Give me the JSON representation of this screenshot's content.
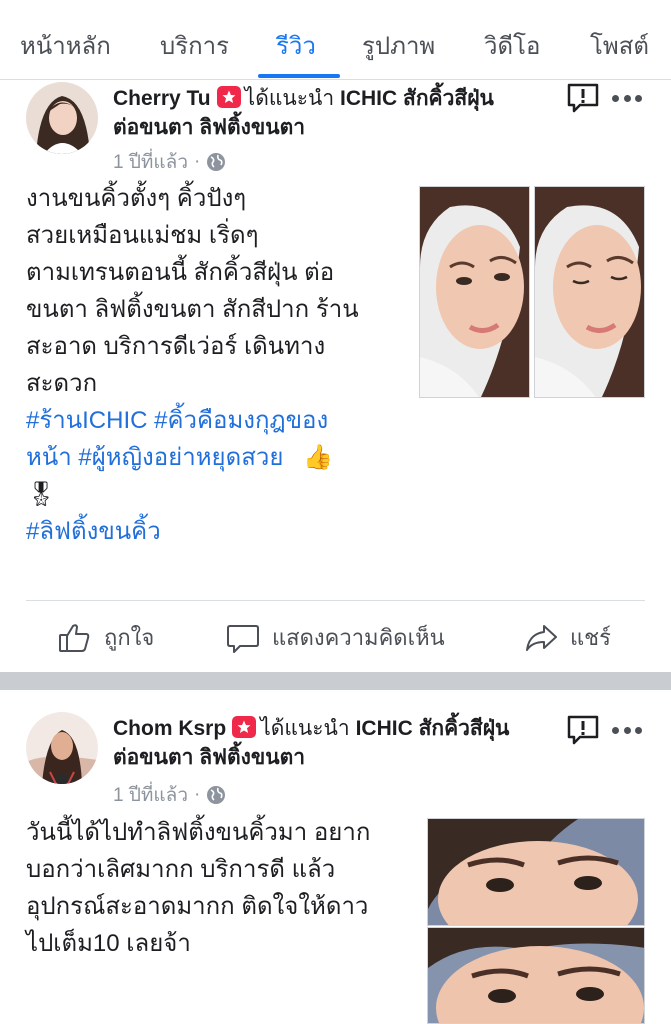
{
  "tabs": [
    {
      "label": "หน้าหลัก",
      "active": false
    },
    {
      "label": "บริการ",
      "active": false
    },
    {
      "label": "รีวิว",
      "active": true
    },
    {
      "label": "รูปภาพ",
      "active": false
    },
    {
      "label": "วิดีโอ",
      "active": false
    },
    {
      "label": "โพสต์",
      "active": false
    }
  ],
  "posts": [
    {
      "author": "Cherry Tu",
      "recommend_text": "ได้แนะนำ",
      "page_name_line1": "ICHIC สักคิ้วสีฝุ่น",
      "page_name_line2": "ต่อขนตา ลิฟติ้งขนตา",
      "time": "1 ปีที่แล้ว",
      "privacy_icon": "globe-icon",
      "text_lines": [
        "งานขนคิ้วตั้งๆ  คิ้วปังๆ",
        "สวยเหมือนแม่ชม  เริ่ดๆ",
        "ตามเทรนตอนนี้ สักคิ้วสีฝุ่น ต่อ",
        "ขนตา ลิฟติ้งขนตา สักสีปาก  ร้าน",
        "สะอาด บริการดีเว่อร์ เดินทาง",
        "สะดวก"
      ],
      "hashtag_line1": "#ร้านICHIC #คิ้วคือมงกุฎของ",
      "hashtag_line2": "หน้า #ผู้หญิงอย่าหยุดสวย",
      "emoji_thumbs": "👍",
      "emoji_medal": "🎖",
      "hashtag_line3": "#ลิฟติ้งขนคิ้ว",
      "actions": {
        "like": "ถูกใจ",
        "comment": "แสดงความคิดเห็น",
        "share": "แชร์"
      }
    },
    {
      "author": "Chom Ksrp",
      "recommend_text": "ได้แนะนำ",
      "page_name_line1": "ICHIC สักคิ้วสีฝุ่น",
      "page_name_line2": "ต่อขนตา ลิฟติ้งขนตา",
      "time": "1 ปีที่แล้ว",
      "privacy_icon": "globe-icon",
      "text_lines": [
        "วันนี้ได้ไปทำลิฟติ้งขนคิ้วมา อยาก",
        "บอกว่าเลิศมากก บริการดี แล้ว",
        "อุปกรณ์สะอาดมากก ติดใจให้ดาว",
        "ไปเต็ม10 เลยจ้า"
      ]
    }
  ],
  "colors": {
    "accent": "#1877f2",
    "hashtag": "#216fdb",
    "badge": "#f02849",
    "separator": "#c9ccd1"
  }
}
